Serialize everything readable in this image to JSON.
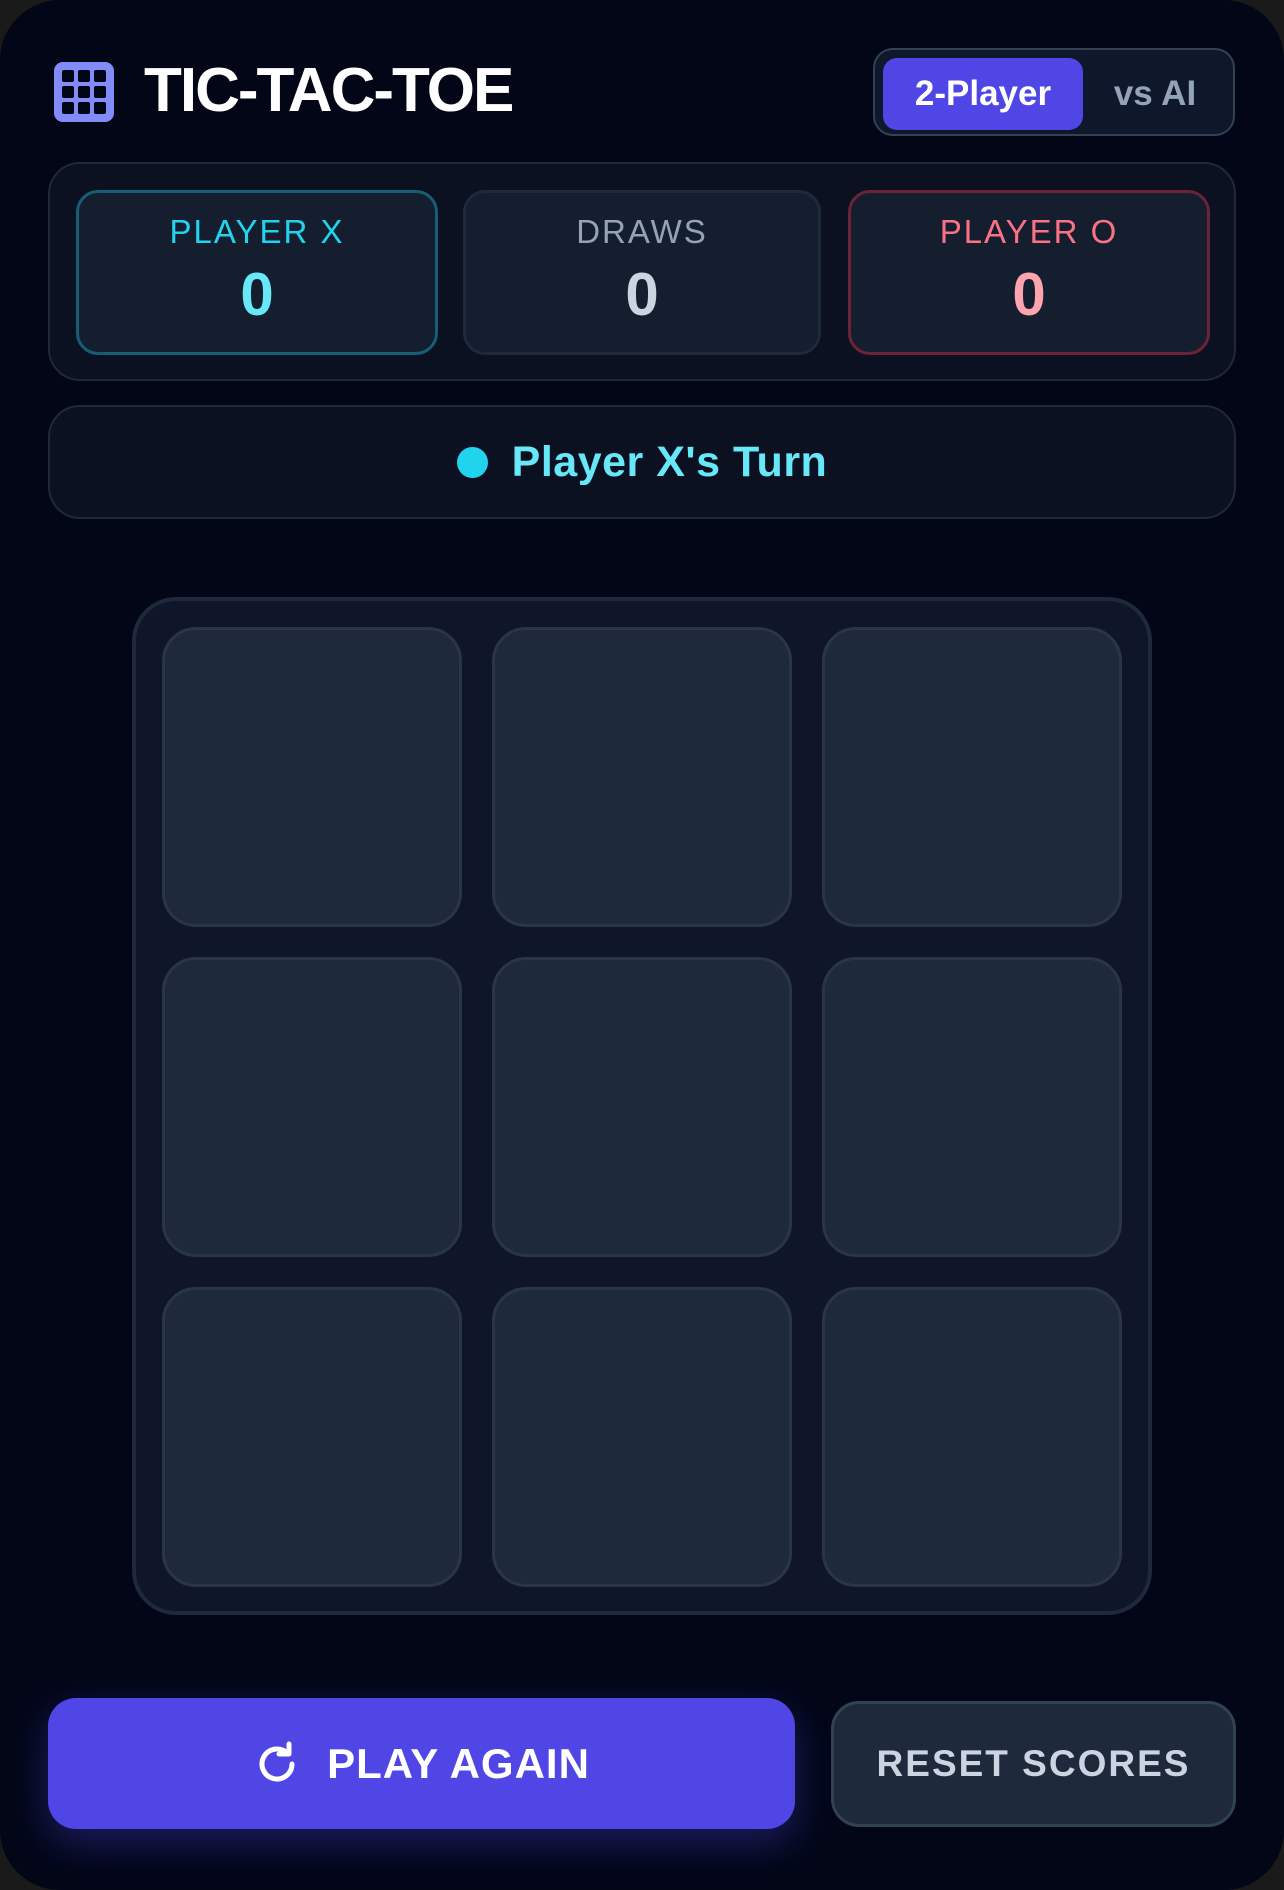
{
  "header": {
    "title": "TIC-TAC-TOE",
    "logo_icon": "grid-icon"
  },
  "mode_toggle": {
    "options": [
      "2-Player",
      "vs AI"
    ],
    "selected": "2-Player"
  },
  "scoreboard": {
    "player_x": {
      "label": "PLAYER X",
      "value": "0"
    },
    "draws": {
      "label": "DRAWS",
      "value": "0"
    },
    "player_o": {
      "label": "PLAYER O",
      "value": "0"
    }
  },
  "status": {
    "text": "Player X's Turn",
    "indicator_color": "#22d3ee"
  },
  "board": {
    "cells": [
      "",
      "",
      "",
      "",
      "",
      "",
      "",
      "",
      ""
    ]
  },
  "actions": {
    "play_again": "PLAY AGAIN",
    "play_again_icon": "refresh-icon",
    "reset_scores": "RESET SCORES"
  },
  "colors": {
    "accent": "#4f46e5",
    "player_x": "#22d3ee",
    "player_o": "#fb7185",
    "background": "#020617"
  }
}
